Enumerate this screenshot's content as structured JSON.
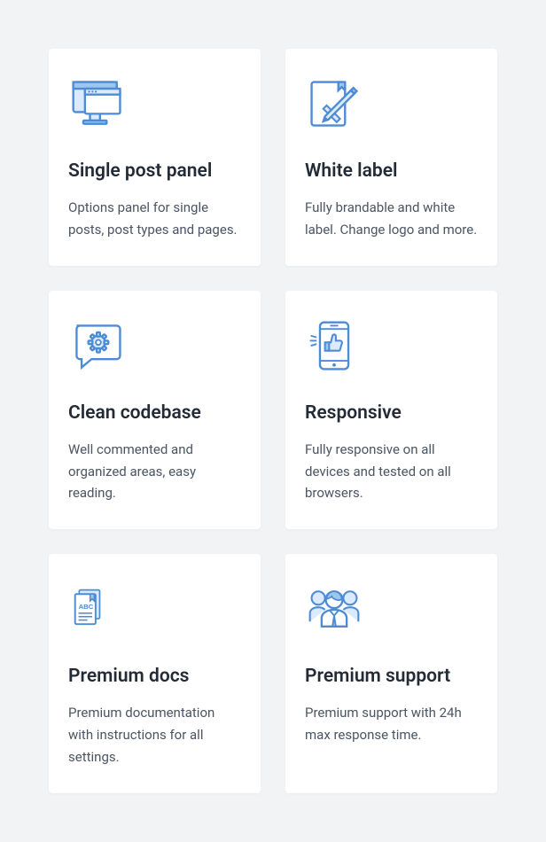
{
  "features": [
    {
      "title": "Single post panel",
      "description": "Options panel for single posts, post types and pages."
    },
    {
      "title": "White label",
      "description": "Fully brandable and white label. Change logo and more."
    },
    {
      "title": "Clean codebase",
      "description": "Well commented and organized areas, easy reading."
    },
    {
      "title": "Responsive",
      "description": "Fully responsive on all devices and tested on all browsers."
    },
    {
      "title": "Premium docs",
      "description": "Premium documentation with instructions for all settings."
    },
    {
      "title": "Premium support",
      "description": "Premium support with 24h max response time."
    }
  ]
}
